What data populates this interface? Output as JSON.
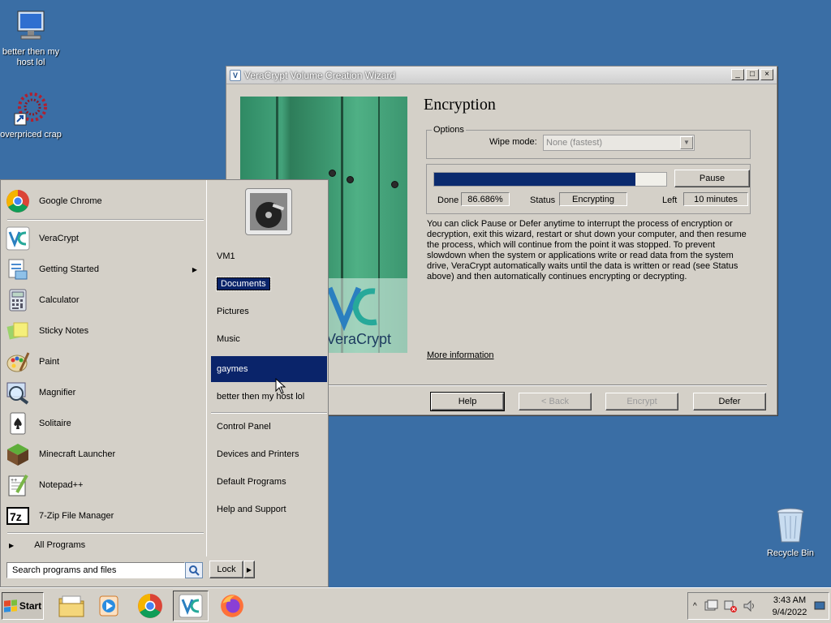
{
  "desktop": {
    "icons": [
      {
        "label": "better then my host lol"
      },
      {
        "label": "overpriced crap"
      },
      {
        "label": "Recycle Bin"
      }
    ]
  },
  "window": {
    "title": "VeraCrypt Volume Creation Wizard",
    "heading": "Encryption",
    "image_brand": "VeraCrypt",
    "options_legend": "Options",
    "wipe_mode_label": "Wipe mode:",
    "wipe_mode_value": "None (fastest)",
    "progress_fraction": 0.86686,
    "pause_label": "Pause",
    "done_label": "Done",
    "done_value": "86.686%",
    "status_label": "Status",
    "status_value": "Encrypting",
    "left_label": "Left",
    "left_value": "10 minutes",
    "info_text": "You can click Pause or Defer anytime to interrupt the process of encryption or decryption, exit this wizard, restart or shut down your computer, and then resume the process, which will continue from the point it was stopped. To prevent slowdown when the system or applications write or read data from the system drive, VeraCrypt automatically waits until the data is written or read (see Status above) and then automatically continues encrypting or decrypting.",
    "more_info": "More information",
    "buttons": {
      "help": "Help",
      "back": "< Back",
      "encrypt": "Encrypt",
      "defer": "Defer"
    }
  },
  "start_menu": {
    "programs": [
      {
        "label": "Google Chrome",
        "icon": "chrome-icon"
      },
      {
        "label": "VeraCrypt",
        "icon": "veracrypt-icon"
      },
      {
        "label": "Getting Started",
        "icon": "getting-started-icon"
      },
      {
        "label": "Calculator",
        "icon": "calculator-icon"
      },
      {
        "label": "Sticky Notes",
        "icon": "sticky-notes-icon"
      },
      {
        "label": "Paint",
        "icon": "paint-icon"
      },
      {
        "label": "Magnifier",
        "icon": "magnifier-icon"
      },
      {
        "label": "Solitaire",
        "icon": "solitaire-icon"
      },
      {
        "label": "Minecraft Launcher",
        "icon": "minecraft-icon"
      },
      {
        "label": "Notepad++",
        "icon": "notepadpp-icon"
      },
      {
        "label": "7-Zip File Manager",
        "icon": "7zip-icon"
      }
    ],
    "all_programs": "All Programs",
    "search_placeholder": "Search programs and files",
    "right_items": {
      "vm1": "VM1",
      "documents": "Documents",
      "pictures": "Pictures",
      "music": "Music",
      "gaymes": "gaymes",
      "host": "better then my host lol",
      "control_panel": "Control Panel",
      "devices": "Devices and Printers",
      "default_programs": "Default Programs",
      "help": "Help and Support"
    },
    "lock_label": "Lock"
  },
  "taskbar": {
    "start_label": "Start",
    "pinned": [
      "explorer-icon",
      "media-player-icon",
      "chrome-icon",
      "veracrypt-icon",
      "firefox-icon"
    ],
    "time": "3:43 AM",
    "date": "9/4/2022"
  },
  "colors": {
    "desktop": "#3a6ea5",
    "selection": "#0a246a",
    "progress": "#0a2a6e"
  }
}
